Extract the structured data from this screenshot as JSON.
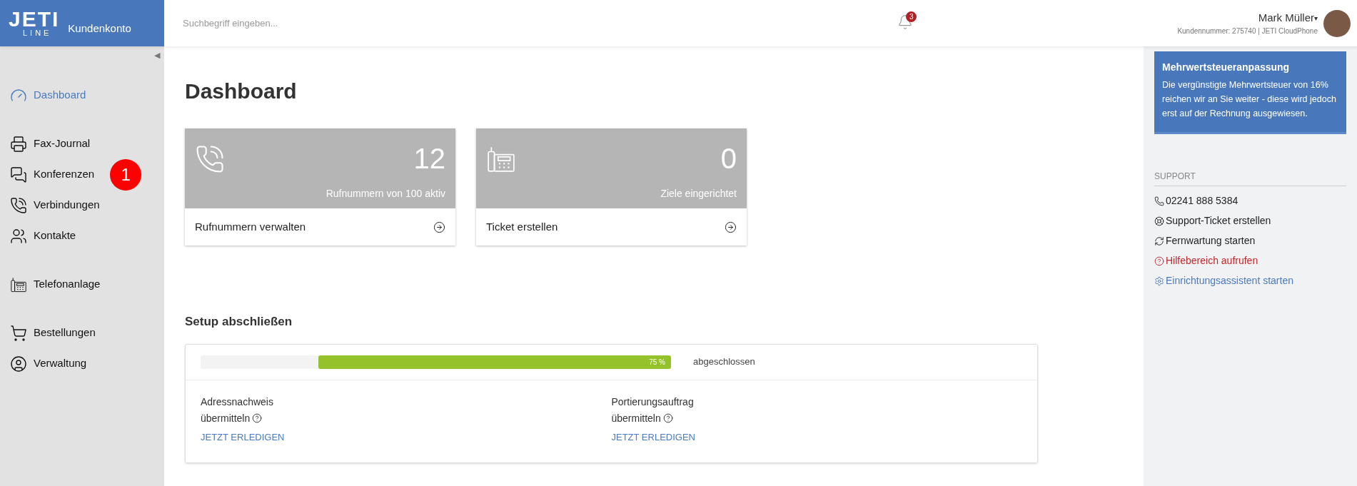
{
  "header": {
    "logo_top": "JETI",
    "logo_bottom": "LINE",
    "product": "Kundenkonto",
    "search": {
      "placeholder": "Suchbegriff eingeben..."
    },
    "notifications": "3",
    "user": {
      "name": "Mark Müller",
      "caret": "▾",
      "details": "Kundennummer: 275740 | JETI CloudPhone"
    }
  },
  "sidebar": {
    "collapse": "◀",
    "groups": [
      [
        {
          "label": "Dashboard",
          "selected": true
        }
      ],
      [
        {
          "label": "Fax-Journal",
          "selected": false
        },
        {
          "label": "Konferenzen",
          "selected": false,
          "badge": "1"
        },
        {
          "label": "Verbindungen",
          "selected": false
        },
        {
          "label": "Kontakte",
          "selected": false
        }
      ],
      [
        {
          "label": "Telefonanlage",
          "selected": false
        }
      ],
      [
        {
          "label": "Bestellungen",
          "selected": false
        },
        {
          "label": "Verwaltung",
          "selected": false
        }
      ]
    ]
  },
  "main": {
    "title": "Dashboard",
    "cards": [
      {
        "kind": "phone",
        "value": "12",
        "caption": "Rufnummern von 100 aktiv",
        "action": "Rufnummern verwalten"
      },
      {
        "kind": "desk-phone",
        "value": "0",
        "caption": "Ziele eingerichtet",
        "action": "Ticket erstellen"
      }
    ],
    "setup": {
      "title": "Setup abschließen",
      "progress": {
        "level": 0.75,
        "reading": "75 %",
        "label": "abgeschlossen"
      },
      "tasks": [
        {
          "line1": "Adressnachweis",
          "line2": "übermitteln",
          "link": "JETZT ERLEDIGEN"
        },
        {
          "line1": "Portierungsauftrag",
          "line2": "übermitteln",
          "link": "JETZT ERLEDIGEN"
        }
      ]
    }
  },
  "right_panel": {
    "notice": {
      "title": "Mehrwertsteueranpassung",
      "text": "Die vergünstigte Mehrwertsteuer von 16% reichen wir an Sie weiter - diese wird jedoch erst auf der Rechnung ausgewiesen."
    },
    "support": {
      "title": "SUPPORT",
      "items": [
        {
          "label": "02241 888 5384",
          "color": "#222222"
        },
        {
          "label": "Support-Ticket erstellen",
          "color": "#222222"
        },
        {
          "label": "Fernwartung starten",
          "color": "#222222"
        },
        {
          "label": "Hilfebereich aufrufen",
          "color": "#c0282d"
        },
        {
          "label": "Einrichtungsassistent starten",
          "color": "#4a7abf"
        }
      ]
    }
  }
}
